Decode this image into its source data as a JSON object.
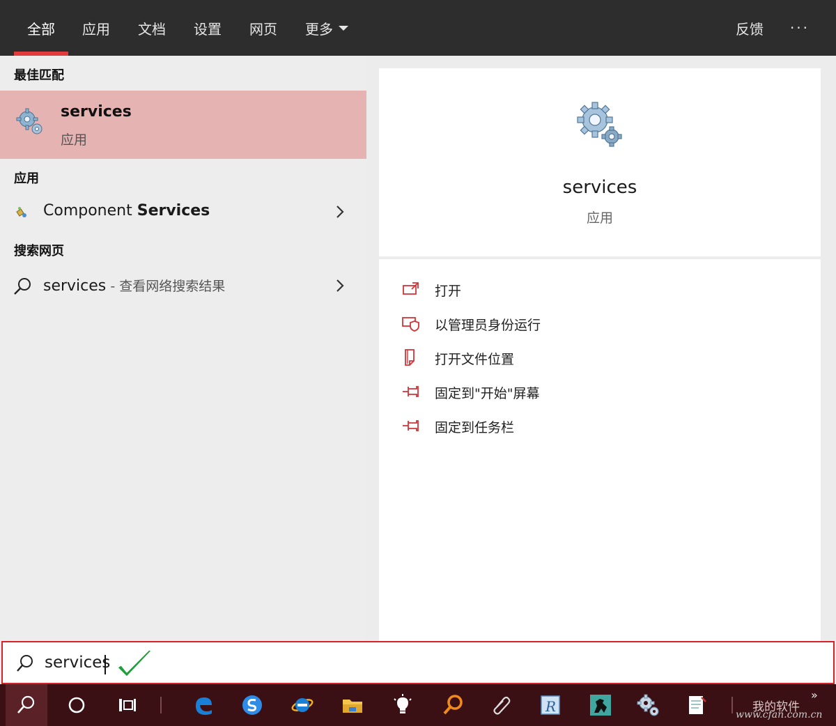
{
  "tabs": [
    {
      "label": "全部",
      "active": true
    },
    {
      "label": "应用",
      "active": false
    },
    {
      "label": "文档",
      "active": false
    },
    {
      "label": "设置",
      "active": false
    },
    {
      "label": "网页",
      "active": false
    },
    {
      "label": "更多",
      "active": false
    }
  ],
  "feedback_label": "反馈",
  "more_options_label": "···",
  "sections": {
    "best_match": "最佳匹配",
    "apps": "应用",
    "web": "搜索网页"
  },
  "best_match": {
    "name": "services",
    "type": "应用",
    "icon": "gears-icon"
  },
  "apps_results": [
    {
      "prefix": "Component ",
      "highlight": "Services",
      "icon": "component-services-icon"
    }
  ],
  "web_results": [
    {
      "query": "services",
      "suffix": " - 查看网络搜索结果",
      "icon": "search-icon"
    }
  ],
  "preview": {
    "title": "services",
    "subtitle": "应用"
  },
  "actions": [
    {
      "label": "打开",
      "icon": "open-icon"
    },
    {
      "label": "以管理员身份运行",
      "icon": "shield-admin-icon"
    },
    {
      "label": "打开文件位置",
      "icon": "file-location-icon"
    },
    {
      "label": "固定到\"开始\"屏幕",
      "icon": "pin-icon"
    },
    {
      "label": "固定到任务栏",
      "icon": "pin-icon"
    }
  ],
  "search": {
    "value": "services"
  },
  "taskbar": {
    "label": "我的软件",
    "chevron": "»",
    "items": [
      "search",
      "cortana",
      "task-view",
      "edge",
      "sogou",
      "ie",
      "file-explorer",
      "tips",
      "search-app",
      "paperclip",
      "r-app",
      "horse-app",
      "gear-app",
      "notepad"
    ]
  },
  "watermark": "www.cfan.com.cn",
  "colors": {
    "accent": "#e23b3b",
    "best_match_bg": "#e6b3b3",
    "topbar_bg": "#2d2d2d",
    "taskbar_bg": "#3a1014",
    "check_green": "#1e9e3a"
  }
}
